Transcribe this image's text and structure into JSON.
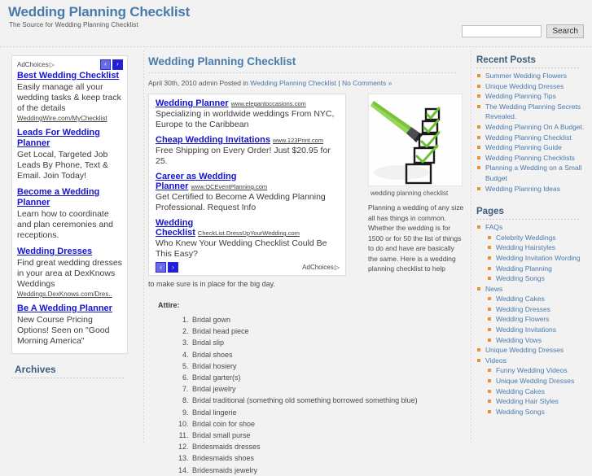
{
  "header": {
    "site_title": "Wedding Planning Checklist",
    "tagline": "The Source for Wedding Planning Checklist",
    "search_value": "",
    "search_placeholder": "",
    "search_button": "Search"
  },
  "left_ads": {
    "adchoices_label": "AdChoices",
    "prev_arrow": "‹",
    "next_arrow": "›",
    "items": [
      {
        "title": "Best Wedding Checklist",
        "desc": "Easily manage all your wedding tasks & keep track of the details",
        "url": "WeddingWire.com/MyChecklist"
      },
      {
        "title": "Leads For Wedding Planner",
        "desc": "Get Local, Targeted Job Leads By Phone, Text & Email. Join Today!",
        "url": ""
      },
      {
        "title": "Become a Wedding Planner",
        "desc": "Learn how to coordinate and plan ceremonies and receptions.",
        "url": ""
      },
      {
        "title": "Wedding Dresses",
        "desc": "Find great wedding dresses in your area at DexKnows Weddings",
        "url": "Weddings.DexKnows.com/Dres.."
      },
      {
        "title": "Be A Wedding Planner",
        "desc": "New Course Pricing Options! Seen on \"Good Morning America\"",
        "url": ""
      }
    ],
    "archives_heading": "Archives"
  },
  "post": {
    "title": "Wedding Planning Checklist",
    "meta_date": "April 30th, 2010",
    "meta_author": "admin",
    "meta_posted_in": "Posted in",
    "meta_category": "Wedding Planning Checklist",
    "meta_separator": "|",
    "meta_comments": "No Comments »",
    "figure_caption": "wedding planning checklist",
    "figure_text": "Planning a wedding of any size all has things in common. Whether the wedding is for 1500 or for 50 the list of things to do and have are basically the same. Here is a wedding planning checklist to help",
    "body_text": "to make sure is in place for the big day.",
    "attire_heading": "Attire:",
    "attire_items": [
      "Bridal gown",
      "Bridal head piece",
      "Bridal slip",
      "Bridal shoes",
      "Bridal hosiery",
      "Bridal garter(s)",
      "Bridal jewelry",
      "Bridal traditional (something old something borrowed something blue)",
      "Bridal lingerie",
      "Bridal coin for shoe",
      "Bridal small purse",
      "Bridesmaids dresses",
      "Bridesmaids shoes",
      "Bridesmaids jewelry"
    ]
  },
  "center_ads": {
    "adchoices_label": "AdChoices",
    "prev_arrow": "‹",
    "next_arrow": "›",
    "items": [
      {
        "title": "Wedding Planner",
        "url": "www.elegantoccasions.com",
        "desc": "Specializing in worldwide weddings From NYC, Europe to the Caribbean"
      },
      {
        "title": "Cheap Wedding Invitations",
        "url": "www.123Print.com",
        "desc": "Free Shipping on Every Order! Just $20.95 for 25."
      },
      {
        "title": "Career as Wedding Planner",
        "url": "www.QCEventPlanning.com",
        "desc": "Get Certified to Become A Wedding Planning Professional. Request Info"
      },
      {
        "title": "Wedding Checklist",
        "url": "CheckList.DressUpYourWedding.com",
        "desc": "Who Knew Your Wedding Checklist Could Be This Easy?"
      }
    ]
  },
  "sidebar": {
    "recent_posts_heading": "Recent Posts",
    "recent_posts": [
      "Summer Wedding Flowers",
      "Unique Wedding Dresses",
      "Wedding Planning Tips",
      "The Wedding Planning Secrets Revealed.",
      "Wedding Planning On A Budget.",
      "Wedding Planning Checklist",
      "Wedding Planning Guide",
      "Wedding Planning Checklists",
      "Planning a Wedding on a Small Budget",
      "Wedding Planning Ideas"
    ],
    "pages_heading": "Pages",
    "pages": [
      {
        "label": "FAQs",
        "sub": false
      },
      {
        "label": "Celebrity Weddings",
        "sub": true
      },
      {
        "label": "Wedding Hairstyles",
        "sub": true
      },
      {
        "label": "Wedding Invitation Wording",
        "sub": true
      },
      {
        "label": "Wedding Planning",
        "sub": true
      },
      {
        "label": "Wedding Songs",
        "sub": true
      },
      {
        "label": "News",
        "sub": false
      },
      {
        "label": "Wedding Cakes",
        "sub": true
      },
      {
        "label": "Wedding Dresses",
        "sub": true
      },
      {
        "label": "Wedding Flowers",
        "sub": true
      },
      {
        "label": "Wedding Invitations",
        "sub": true
      },
      {
        "label": "Wedding Vows",
        "sub": true
      },
      {
        "label": "Unique Wedding Dresses",
        "sub": false
      },
      {
        "label": "Videos",
        "sub": false
      },
      {
        "label": "Funny Wedding Videos",
        "sub": true
      },
      {
        "label": "Unique Wedding Dresses",
        "sub": true
      },
      {
        "label": "Wedding Cakes",
        "sub": true
      },
      {
        "label": "Wedding Hair Styles",
        "sub": true
      },
      {
        "label": "Wedding Songs",
        "sub": true
      }
    ]
  },
  "colors": {
    "brand_blue": "#4a7aab",
    "ad_link_blue": "#1414cc",
    "bullet_orange": "#e8913c",
    "page_bg": "#f2f2f2",
    "checkmark_green": "#6cbf33"
  }
}
